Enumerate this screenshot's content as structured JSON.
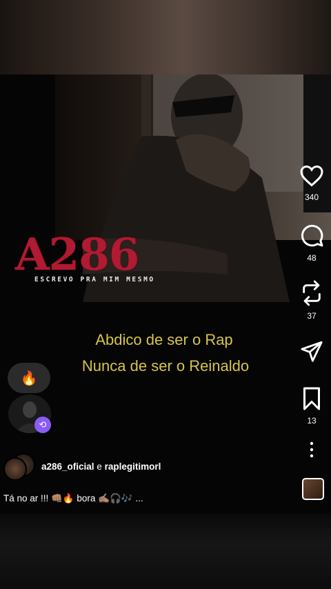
{
  "cover": {
    "logo_text": "A286",
    "logo_subtitle": "ESCREVO PRA MIM MESMO"
  },
  "lyrics": {
    "line1": "Abdico de ser o Rap",
    "line2": "Nunca de ser o Reinaldo"
  },
  "actions": {
    "likes": "340",
    "comments": "48",
    "reposts": "37",
    "saves": "13"
  },
  "reaction_bubble": "🔥",
  "accounts": {
    "first": "a286_oficial",
    "connector": "e",
    "second": "raplegitimorl"
  },
  "caption": "Tá no ar !!! 👊🏽🔥 bora ✍🏽🎧🎶 ...",
  "colors": {
    "lyric": "#d6c54a",
    "logo": "#b01a32",
    "remix_badge": "#8b5cf6"
  }
}
